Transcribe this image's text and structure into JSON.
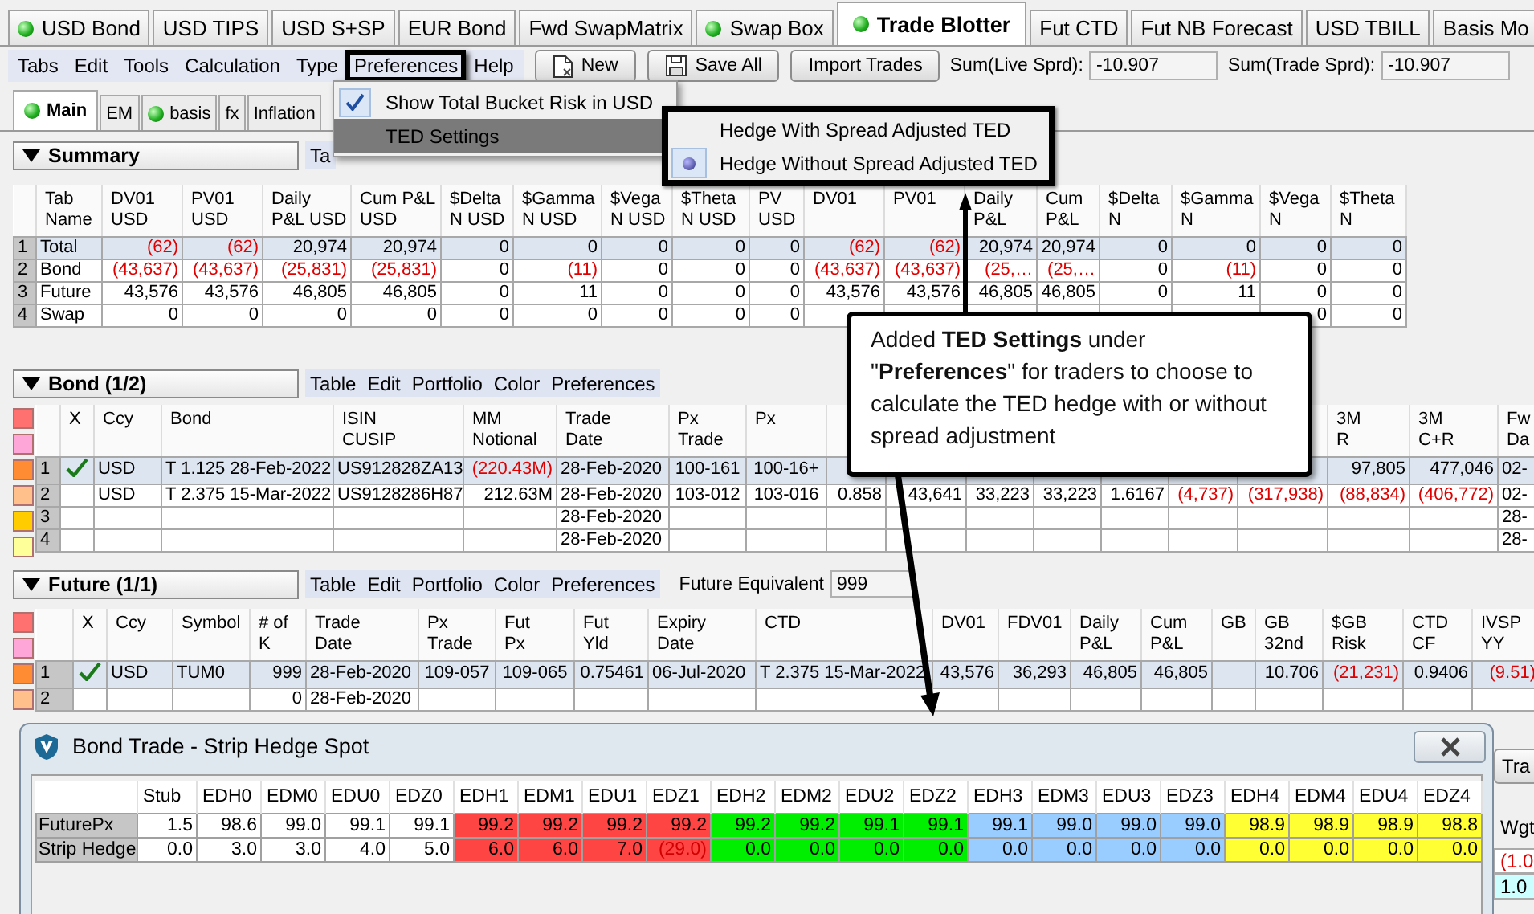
{
  "tabs": [
    {
      "label": "USD Bond",
      "dot": true,
      "selected": false
    },
    {
      "label": "USD TIPS",
      "dot": false,
      "selected": false
    },
    {
      "label": "USD S+SP",
      "dot": false,
      "selected": false
    },
    {
      "label": "EUR Bond",
      "dot": false,
      "selected": false
    },
    {
      "label": "Fwd SwapMatrix",
      "dot": false,
      "selected": false
    },
    {
      "label": "Swap Box",
      "dot": true,
      "selected": false
    },
    {
      "label": "Trade Blotter",
      "dot": true,
      "selected": true
    },
    {
      "label": "Fut CTD",
      "dot": false,
      "selected": false
    },
    {
      "label": "Fut NB Forecast",
      "dot": false,
      "selected": false
    },
    {
      "label": "USD TBILL",
      "dot": false,
      "selected": false
    },
    {
      "label": "Basis Mo",
      "dot": false,
      "selected": false
    }
  ],
  "menu_bar": [
    {
      "label": "Tabs",
      "annotated": false
    },
    {
      "label": "Edit",
      "annotated": false
    },
    {
      "label": "Tools",
      "annotated": false
    },
    {
      "label": "Calculation",
      "annotated": false
    },
    {
      "label": "Type",
      "annotated": false
    },
    {
      "label": "Preferences",
      "annotated": true
    },
    {
      "label": "Help",
      "annotated": false
    }
  ],
  "toolbar": {
    "buttons": [
      {
        "label": "New",
        "kind": "new"
      },
      {
        "label": "Save All",
        "kind": "save"
      },
      {
        "label": "Import Trades",
        "kind": "plain"
      }
    ],
    "fields": [
      {
        "label": "Sum(Live Sprd):",
        "value": "-10.907"
      },
      {
        "label": "Sum(Trade Sprd):",
        "value": "-10.907"
      }
    ]
  },
  "subtabs": [
    {
      "label": "Main",
      "dot": true,
      "selected": true
    },
    {
      "label": "EM",
      "dot": false,
      "selected": false
    },
    {
      "label": "basis",
      "dot": true,
      "selected": false
    },
    {
      "label": "fx",
      "dot": false,
      "selected": false
    },
    {
      "label": "Inflation",
      "dot": false,
      "selected": false
    }
  ],
  "summary": {
    "title": "Summary",
    "menu": [
      "Ta"
    ],
    "columns": [
      "Tab\nName",
      "DV01\nUSD",
      "PV01\nUSD",
      "Daily\nP&L USD",
      "Cum P&L\nUSD",
      "$Delta\nN USD",
      "$Gamma\nN USD",
      "$Vega\nN USD",
      "$Theta\nN USD",
      "PV\nUSD",
      "DV01",
      "PV01",
      "Daily\nP&L",
      "Cum\nP&L",
      "$Delta\nN",
      "$Gamma\nN",
      "$Vega\nN",
      "$Theta\nN"
    ],
    "rows": [
      {
        "number": "1",
        "cells": [
          "Total",
          {
            "text": "(62)",
            "negative": true
          },
          {
            "text": "(62)",
            "negative": true
          },
          "20,974",
          "20,974",
          "0",
          "0",
          "0",
          "0",
          "0",
          {
            "text": "(62)",
            "negative": true
          },
          {
            "text": "(62)",
            "negative": true
          },
          "20,974",
          "20,974",
          "0",
          "0",
          "0",
          "0"
        ]
      },
      {
        "number": "2",
        "cells": [
          "Bond",
          {
            "text": "(43,637)",
            "negative": true
          },
          {
            "text": "(43,637)",
            "negative": true
          },
          {
            "text": "(25,831)",
            "negative": true
          },
          {
            "text": "(25,831)",
            "negative": true
          },
          "0",
          {
            "text": "(11)",
            "negative": true
          },
          "0",
          "0",
          "0",
          {
            "text": "(43,637)",
            "negative": true
          },
          {
            "text": "(43,637)",
            "negative": true
          },
          {
            "text": "(25,…",
            "negative": true
          },
          {
            "text": "(25,…",
            "negative": true
          },
          "0",
          {
            "text": "(11)",
            "negative": true
          },
          "0",
          "0"
        ]
      },
      {
        "number": "3",
        "cells": [
          "Future",
          "43,576",
          "43,576",
          "46,805",
          "46,805",
          "0",
          "11",
          "0",
          "0",
          "0",
          "43,576",
          "43,576",
          "46,805",
          "46,805",
          "0",
          "11",
          "0",
          "0"
        ]
      },
      {
        "number": "4",
        "cells": [
          "Swap",
          "0",
          "0",
          "0",
          "0",
          "0",
          "0",
          "0",
          "0",
          "0",
          null,
          null,
          null,
          null,
          null,
          null,
          "0",
          "0"
        ]
      }
    ]
  },
  "bond": {
    "title": "Bond (1/2)",
    "menu": [
      "Table",
      "Edit",
      "Portfolio",
      "Color",
      "Preferences"
    ],
    "swatches": [
      {
        "color": "#ff7070"
      },
      {
        "color": "#ffa6d8"
      },
      {
        "color": "#ff8c33"
      },
      {
        "color": "#ffc08c"
      },
      {
        "color": "#ffcc00"
      },
      {
        "color": "#ffff99"
      }
    ],
    "columns": [
      "X",
      "Ccy",
      "Bond",
      "ISIN\nCUSIP",
      "MM\nNotional",
      "Trade\nDate",
      "Px\nTrade",
      "Px",
      null,
      null,
      null,
      null,
      null,
      null,
      null,
      "3M\nR",
      "3M\nC+R",
      "Fw\nDa"
    ],
    "rows": [
      {
        "number": "1",
        "cells": [
          {
            "checked": true
          },
          "USD",
          "T 1.125 28-Feb-2022",
          "US912828ZA13",
          {
            "text": "(220.43M)",
            "negative": true
          },
          "28-Feb-2020",
          "100-161",
          "100-16+",
          null,
          null,
          null,
          null,
          null,
          null,
          null,
          "97,805",
          "477,046",
          "02-"
        ]
      },
      {
        "number": "2",
        "cells": [
          {
            "checked": false
          },
          "USD",
          "T 2.375 15-Mar-2022",
          "US9128286H87",
          "212.63M",
          "28-Feb-2020",
          "103-012",
          "103-016",
          "0.858",
          "43,641",
          "33,223",
          "33,223",
          "1.6167",
          {
            "text": "(4,737)",
            "negative": true
          },
          {
            "text": "(317,938)",
            "negative": true
          },
          {
            "text": "(88,834)",
            "negative": true
          },
          {
            "text": "(406,772)",
            "negative": true
          },
          "02-"
        ]
      },
      {
        "number": "3",
        "cells": [
          {
            "checked": false
          },
          null,
          null,
          null,
          null,
          "28-Feb-2020",
          null,
          null,
          null,
          null,
          null,
          null,
          null,
          null,
          null,
          null,
          null,
          "28-"
        ]
      },
      {
        "number": "4",
        "cells": [
          {
            "checked": false
          },
          null,
          null,
          null,
          null,
          "28-Feb-2020",
          null,
          null,
          null,
          null,
          null,
          null,
          null,
          null,
          null,
          null,
          null,
          "28-"
        ]
      }
    ]
  },
  "future": {
    "title": "Future (1/1)",
    "menu": [
      "Table",
      "Edit",
      "Portfolio",
      "Color",
      "Preferences"
    ],
    "equivalent": {
      "label": "Future Equivalent",
      "value": "999"
    },
    "swatches": [
      {
        "color": "#ff7070"
      },
      {
        "color": "#ffa6d8"
      },
      {
        "color": "#ff8c33"
      },
      {
        "color": "#ffc08c"
      }
    ],
    "columns": [
      "X",
      "Ccy",
      "Symbol",
      "# of\nK",
      "Trade\nDate",
      "Px\nTrade",
      "Fut\nPx",
      "Fut\nYld",
      "Expiry\nDate",
      "CTD",
      "DV01",
      "FDV01",
      "Daily\nP&L",
      "Cum\nP&L",
      "GB",
      "GB\n32nd",
      "$GB\nRisk",
      "CTD\nCF",
      "IVSP\nYY"
    ],
    "rows": [
      {
        "number": "1",
        "cells": [
          {
            "checked": true
          },
          "USD",
          "TUM0",
          "999",
          "28-Feb-2020",
          "109-057",
          "109-065",
          "0.75461",
          "06-Jul-2020",
          "T 2.375 15-Mar-2022",
          "43,576",
          "36,293",
          "46,805",
          "46,805",
          null,
          "10.706",
          {
            "text": "(21,231)",
            "negative": true
          },
          "0.9406",
          {
            "text": "(9.51)",
            "negative": true
          }
        ]
      },
      {
        "number": "2",
        "cells": [
          {
            "checked": false
          },
          null,
          null,
          "0",
          "28-Feb-2020",
          null,
          null,
          null,
          null,
          null,
          null,
          null,
          null,
          null,
          null,
          null,
          null,
          null,
          null
        ]
      }
    ]
  },
  "background_right": {
    "button": "Tra",
    "label": "Wgt",
    "values": [
      {
        "text": "(1.0",
        "negative": true
      },
      {
        "text": "1.0"
      }
    ]
  },
  "preferences_menu": {
    "items": [
      {
        "label": "Show Total Bucket Risk in USD",
        "checked": true,
        "highlighted": false
      },
      {
        "label": "TED Settings",
        "checked": false,
        "highlighted": true
      }
    ]
  },
  "ted_submenu": {
    "items": [
      {
        "label": "Hedge With Spread Adjusted TED",
        "selected": false
      },
      {
        "label": "Hedge Without Spread Adjusted TED",
        "selected": true
      }
    ]
  },
  "dialog": {
    "title": "Bond Trade - Strip Hedge Spot",
    "columns": [
      {
        "label": "Stub",
        "color": "#ffffff"
      },
      {
        "label": "EDH0",
        "color": "#ffffff"
      },
      {
        "label": "EDM0",
        "color": "#ffffff"
      },
      {
        "label": "EDU0",
        "color": "#ffffff"
      },
      {
        "label": "EDZ0",
        "color": "#ffffff"
      },
      {
        "label": "EDH1",
        "color": "#ff4444"
      },
      {
        "label": "EDM1",
        "color": "#ff4444"
      },
      {
        "label": "EDU1",
        "color": "#ff4444"
      },
      {
        "label": "EDZ1",
        "color": "#ff4444"
      },
      {
        "label": "EDH2",
        "color": "#00ee00"
      },
      {
        "label": "EDM2",
        "color": "#00ee00"
      },
      {
        "label": "EDU2",
        "color": "#00ee00"
      },
      {
        "label": "EDZ2",
        "color": "#00ee00"
      },
      {
        "label": "EDH3",
        "color": "#99ccff"
      },
      {
        "label": "EDM3",
        "color": "#99ccff"
      },
      {
        "label": "EDU3",
        "color": "#99ccff"
      },
      {
        "label": "EDZ3",
        "color": "#99ccff"
      },
      {
        "label": "EDH4",
        "color": "#ffff33"
      },
      {
        "label": "EDM4",
        "color": "#ffff33"
      },
      {
        "label": "EDU4",
        "color": "#ffff33"
      },
      {
        "label": "EDZ4",
        "color": "#ffff33"
      }
    ],
    "rows": [
      {
        "label": "FuturePx",
        "cells": [
          "1.5",
          "98.6",
          "99.0",
          "99.1",
          "99.1",
          "99.2",
          "99.2",
          "99.2",
          "99.2",
          "99.2",
          "99.2",
          "99.1",
          "99.1",
          "99.1",
          "99.0",
          "99.0",
          "99.0",
          "98.9",
          "98.9",
          "98.9",
          "98.8"
        ]
      },
      {
        "label": "Strip Hedge",
        "cells": [
          "0.0",
          "3.0",
          "3.0",
          "4.0",
          "5.0",
          "6.0",
          "6.0",
          "7.0",
          {
            "text": "(29.0)",
            "negative": true
          },
          "0.0",
          "0.0",
          "0.0",
          "0.0",
          "0.0",
          "0.0",
          "0.0",
          "0.0",
          "0.0",
          "0.0",
          "0.0",
          "0.0"
        ]
      }
    ]
  },
  "callout": {
    "text": "Added **TED Settings** under \"**Preferences**\" for traders to choose to calculate the TED hedge with or without spread adjustment"
  }
}
